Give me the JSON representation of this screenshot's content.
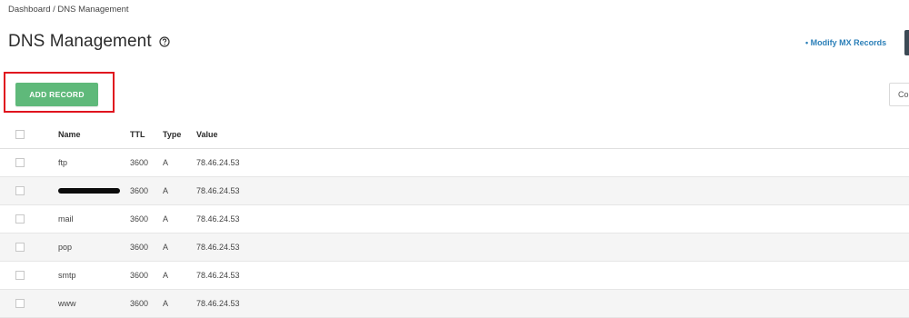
{
  "breadcrumb": {
    "text": "Dashboard / DNS Management"
  },
  "header": {
    "title": "DNS Management",
    "mx_link": "• Modify MX Records"
  },
  "toolbar": {
    "add_record_label": "ADD RECORD",
    "search_fragment": "Co"
  },
  "table": {
    "headers": {
      "name": "Name",
      "ttl": "TTL",
      "type": "Type",
      "value": "Value"
    },
    "rows": [
      {
        "name": "ftp",
        "ttl": "3600",
        "type": "A",
        "value": "78.46.24.53"
      },
      {
        "name": "",
        "ttl": "3600",
        "type": "A",
        "value": "78.46.24.53"
      },
      {
        "name": "mail",
        "ttl": "3600",
        "type": "A",
        "value": "78.46.24.53"
      },
      {
        "name": "pop",
        "ttl": "3600",
        "type": "A",
        "value": "78.46.24.53"
      },
      {
        "name": "smtp",
        "ttl": "3600",
        "type": "A",
        "value": "78.46.24.53"
      },
      {
        "name": "www",
        "ttl": "3600",
        "type": "A",
        "value": "78.46.24.53"
      }
    ]
  },
  "colors": {
    "add_button": "#5fb97a",
    "link": "#2b7fb8",
    "highlight": "#e0141e",
    "dark_button": "#3c4a55"
  }
}
